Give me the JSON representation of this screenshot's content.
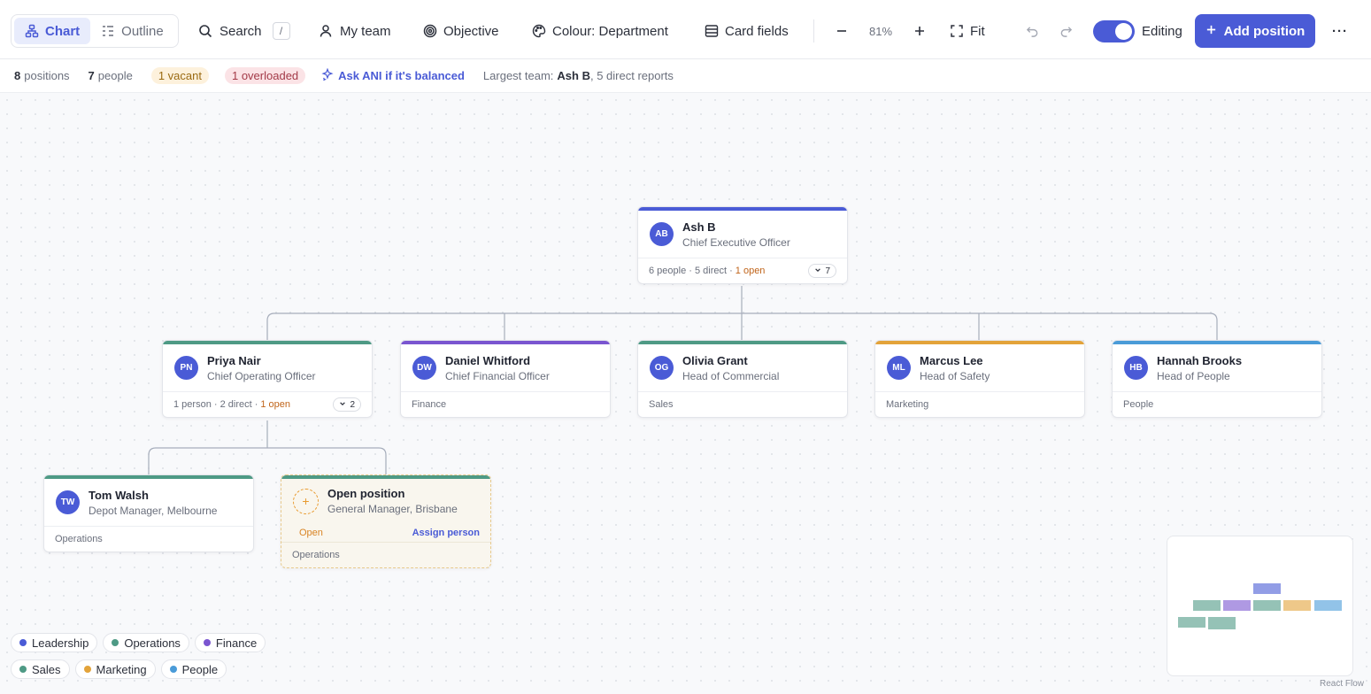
{
  "toolbar": {
    "view_chart": "Chart",
    "view_outline": "Outline",
    "search_label": "Search",
    "search_shortcut": "/",
    "my_team": "My team",
    "objective": "Objective",
    "colour": "Colour: Department",
    "card_fields": "Card fields",
    "zoom": "81%",
    "fit": "Fit",
    "editing_label": "Editing",
    "editing_on": true,
    "add_position": "Add position",
    "more": "···"
  },
  "stats": {
    "positions_count": "8",
    "positions_label": "positions",
    "people_count": "7",
    "people_label": "people",
    "vacant": "1 vacant",
    "overloaded": "1 overloaded",
    "ask_ani": "Ask ANI if it's balanced",
    "largest_prefix": "Largest team:",
    "largest_name": "Ash B",
    "largest_suffix": ", 5 direct reports"
  },
  "colors": {
    "Leadership": "#4a5bd6",
    "Operations": "#4e9a85",
    "Finance": "#7a55d0",
    "Sales": "#4e9a85",
    "Marketing": "#e3a33a",
    "People": "#4a9bd8",
    "accent": "#4a5bd6"
  },
  "nodes": {
    "ash": {
      "initials": "AB",
      "name": "Ash B",
      "role": "Chief Executive Officer",
      "summary": "6 people · 5 direct · ",
      "open": "1 open",
      "count": "7"
    },
    "priya": {
      "initials": "PN",
      "name": "Priya Nair",
      "role": "Chief Operating Officer",
      "summary": "1 person · 2 direct · ",
      "open": "1 open",
      "count": "2"
    },
    "daniel": {
      "initials": "DW",
      "name": "Daniel Whitford",
      "role": "Chief Financial Officer",
      "dept": "Finance"
    },
    "olivia": {
      "initials": "OG",
      "name": "Olivia Grant",
      "role": "Head of Commercial",
      "dept": "Sales"
    },
    "marcus": {
      "initials": "ML",
      "name": "Marcus Lee",
      "role": "Head of Safety",
      "dept": "Marketing"
    },
    "hannah": {
      "initials": "HB",
      "name": "Hannah Brooks",
      "role": "Head of People",
      "dept": "People"
    },
    "tom": {
      "initials": "TW",
      "name": "Tom Walsh",
      "role": "Depot Manager, Melbourne",
      "dept": "Operations"
    },
    "open_position": {
      "icon": "+",
      "name": "Open position",
      "role": "General Manager, Brisbane",
      "status": "Open",
      "assign": "Assign person",
      "dept": "Operations"
    }
  },
  "legend": [
    "Leadership",
    "Operations",
    "Finance",
    "Sales",
    "Marketing",
    "People"
  ],
  "attribution": "React Flow"
}
